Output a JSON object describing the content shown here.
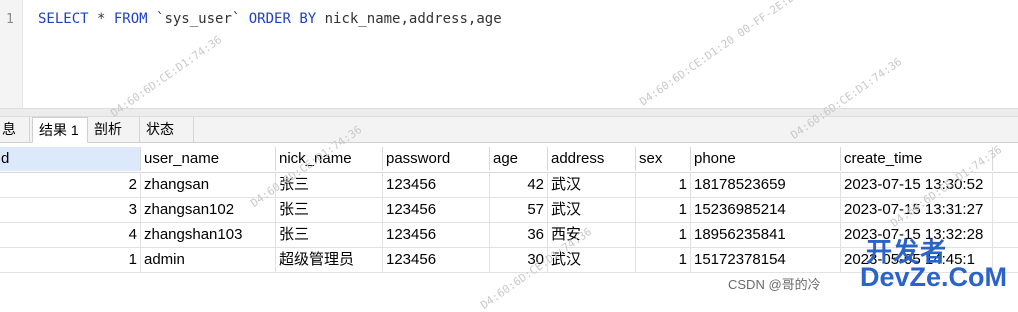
{
  "editor": {
    "line_number": "1",
    "tokens": [
      {
        "t": "SELECT",
        "c": "kw"
      },
      {
        "t": " * ",
        "c": "plain"
      },
      {
        "t": "FROM",
        "c": "kw"
      },
      {
        "t": " `sys_user` ",
        "c": "ident"
      },
      {
        "t": "ORDER BY",
        "c": "kw"
      },
      {
        "t": " nick_name,address,age",
        "c": "ident"
      }
    ]
  },
  "tabs": [
    {
      "label": "息",
      "active": false
    },
    {
      "label": "结果 1",
      "active": true
    },
    {
      "label": "剖析",
      "active": false
    },
    {
      "label": "状态",
      "active": false
    }
  ],
  "table": {
    "columns": [
      "d",
      "user_name",
      "nick_name",
      "password",
      "age",
      "address",
      "sex",
      "phone",
      "create_time"
    ],
    "rows": [
      [
        "2",
        "zhangsan",
        "张三",
        "123456",
        "42",
        "武汉",
        "1",
        "18178523659",
        "2023-07-15 13:30:52"
      ],
      [
        "3",
        "zhangsan102",
        "张三",
        "123456",
        "57",
        "武汉",
        "1",
        "15236985214",
        "2023-07-15 13:31:27"
      ],
      [
        "4",
        "zhangshan103",
        "张三",
        "123456",
        "36",
        "西安",
        "1",
        "18956235841",
        "2023-07-15 13:32:28"
      ],
      [
        "1",
        "admin",
        "超级管理员",
        "123456",
        "30",
        "武汉",
        "1",
        "15172378154",
        "2023-05-05 14:45:1"
      ]
    ]
  },
  "watermarks": {
    "mac_a": "D4:60:6D:CE:D1:74:36",
    "mac_b": "D4:60:6D:CE:D1:20 00-FF-2E:D1:74:36",
    "csdn": "CSDN @哥的冷",
    "logo_top": "开发者",
    "logo_bottom": "DevZe.CoM"
  },
  "colors": {
    "keyword": "#1f41c8",
    "selected_header": "#dbe9fb",
    "logo": "#2b63c9"
  }
}
